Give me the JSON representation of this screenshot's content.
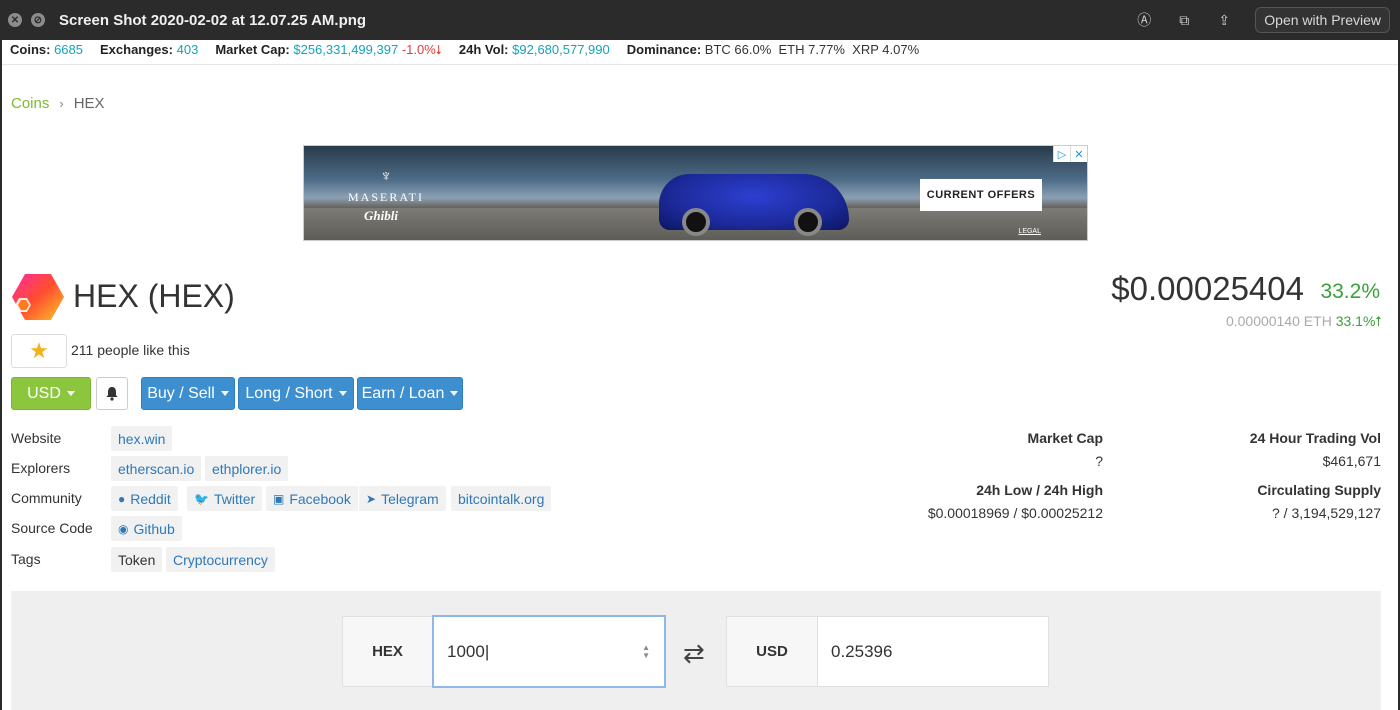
{
  "window": {
    "title": "Screen Shot 2020-02-02 at 12.07.25 AM.png",
    "open_with": "Open with Preview"
  },
  "stats": {
    "coins_label": "Coins:",
    "coins_value": "6685",
    "exchanges_label": "Exchanges:",
    "exchanges_value": "403",
    "marketcap_label": "Market Cap:",
    "marketcap_value": "$256,331,499,397",
    "marketcap_change": "-1.0%",
    "vol_label": "24h Vol:",
    "vol_value": "$92,680,577,990",
    "dominance_label": "Dominance:",
    "dominance_value": "BTC 66.0%  ETH 7.77%  XRP 4.07%"
  },
  "breadcrumb": {
    "root": "Coins",
    "current": "HEX"
  },
  "ad": {
    "brand": "MASERATI",
    "model": "Ghibli",
    "cta": "CURRENT OFFERS",
    "legal": "LEGAL"
  },
  "coin": {
    "name": "HEX (HEX)",
    "price": "$0.00025404",
    "price_change": "33.2%",
    "eth_price": "0.00000140 ETH",
    "eth_change": "33.1%",
    "likes_text": "211 people like this"
  },
  "buttons": {
    "currency": "USD",
    "buy_sell": "Buy / Sell",
    "long_short": "Long / Short",
    "earn_loan": "Earn / Loan"
  },
  "info": {
    "website_label": "Website",
    "website_link": "hex.win",
    "explorers_label": "Explorers",
    "explorers": [
      "etherscan.io",
      "ethplorer.io"
    ],
    "community_label": "Community",
    "community": [
      "Reddit",
      "Twitter",
      "Facebook",
      "Telegram",
      "bitcointalk.org"
    ],
    "source_label": "Source Code",
    "source_link": "Github",
    "tags_label": "Tags",
    "tags": [
      "Token",
      "Cryptocurrency"
    ]
  },
  "metrics": {
    "market_cap_label": "Market Cap",
    "market_cap_value": "?",
    "trading_vol_label": "24 Hour Trading Vol",
    "trading_vol_value": "$461,671",
    "low_high_label": "24h Low / 24h High",
    "low_high_value": "$0.00018969 / $0.00025212",
    "supply_label": "Circulating Supply",
    "supply_value": "? / 3,194,529,127"
  },
  "converter": {
    "from_currency": "HEX",
    "from_value": "1000",
    "to_currency": "USD",
    "to_value": "0.25396"
  },
  "colors": {
    "accent_green": "#8cc63f",
    "button_blue": "#3d8fd0",
    "positive": "#3aa03a",
    "negative": "#e23c3c",
    "link_cyan": "#17a2b8"
  }
}
